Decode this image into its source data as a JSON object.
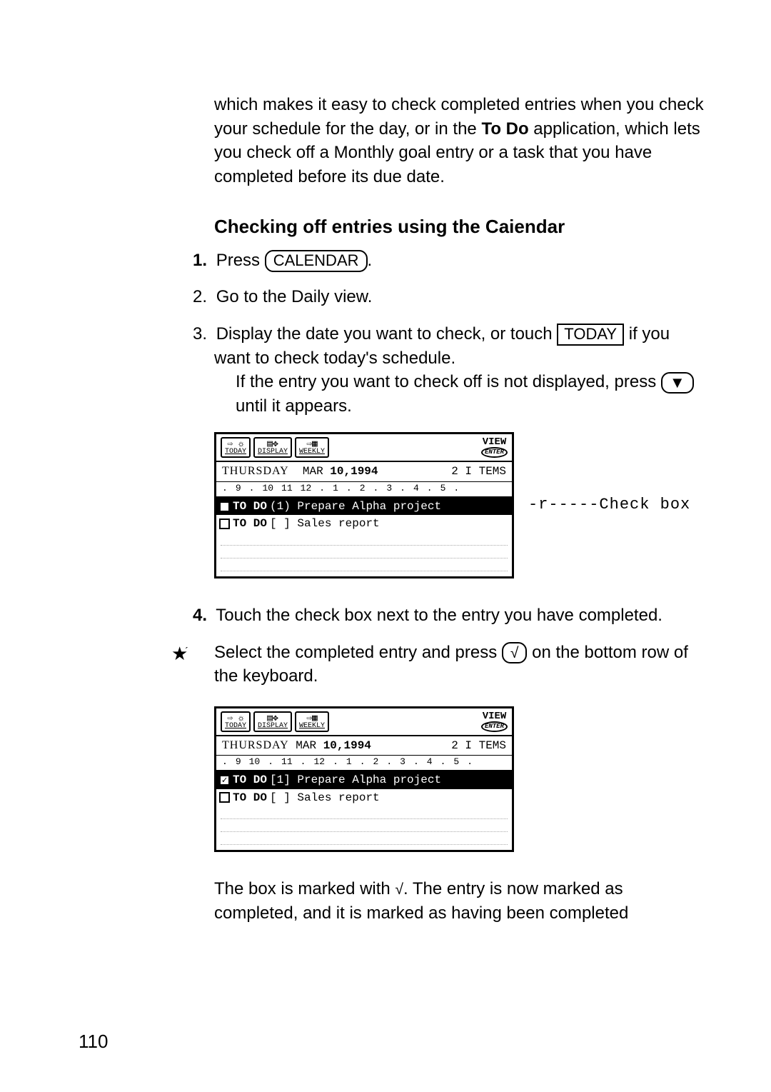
{
  "intro": {
    "p1a": "which makes it easy to check completed entries when you check your schedule for the day, or in the ",
    "p1bold": "To Do",
    "p1b": " application, which lets you check off a Monthly goal entry or a task that you have completed before its due date."
  },
  "section_title": "Checking off entries using the Caiendar",
  "step1": {
    "num": "1.",
    "a": "Press ",
    "key": "CALENDAR",
    "b": "."
  },
  "step2": {
    "num": "2.",
    "text": "Go to the Daily view."
  },
  "step3": {
    "num": "3.",
    "a": "Display the date you want to check, or touch ",
    "key": "TODAY",
    "b": " if you want to check today's schedule.",
    "c": "If the entry you want to check off is not displayed, press ",
    "key2": "▼",
    "d": " until it appears."
  },
  "screen1": {
    "tb": {
      "today": "TODAY",
      "display": "DISPLAY",
      "weekly": "WEEKLY",
      "view": "VIEW",
      "enter": "ENTER"
    },
    "day": "THURSDAY",
    "date_month": "MAR",
    "date_year": "10,1994",
    "items": "2  I TEMS",
    "scale": [
      ".",
      "9",
      ".",
      "10",
      "11",
      "12",
      ".",
      "1",
      ".",
      "2",
      ".",
      "3",
      ".",
      "4",
      ".",
      "5",
      "."
    ],
    "row1": {
      "label": "TO DO",
      "text": "(1) Prepare Alpha project"
    },
    "row2": {
      "label": "TO DO",
      "text": "[ ] Sales  report"
    }
  },
  "callout": "-r-----Check box",
  "step4": {
    "num": "4.",
    "text": "Touch the check box next to the entry you have completed."
  },
  "star_step": {
    "a": "Select the completed entry and press ",
    "key": "√",
    "b": " on the bottom row of the keyboard."
  },
  "screen2": {
    "tb": {
      "today": "TODAY",
      "display": "DISPLAY",
      "weekly": "WEEKLY",
      "view": "VIEW",
      "enter": "ENTER"
    },
    "day": "THURSDAY",
    "date_month": "MAR",
    "date_year": "10,1994",
    "items": "2  I TEMS",
    "scale": [
      ".",
      "9",
      "10",
      ".",
      "11",
      ".",
      "12",
      ".",
      "1",
      ".",
      "2",
      ".",
      "3",
      ".",
      "4",
      ".",
      "5",
      "."
    ],
    "row1": {
      "label": "TO DO",
      "text": "[1] Prepare Alpha project",
      "checked": "✓"
    },
    "row2": {
      "label": "TO DO",
      "text": "[ ] Sales  report"
    }
  },
  "closing": {
    "a": "The box is marked with ",
    "mark": "√",
    "b": ". The entry is now marked as completed, and it is marked as having been completed"
  },
  "page_number": "110"
}
